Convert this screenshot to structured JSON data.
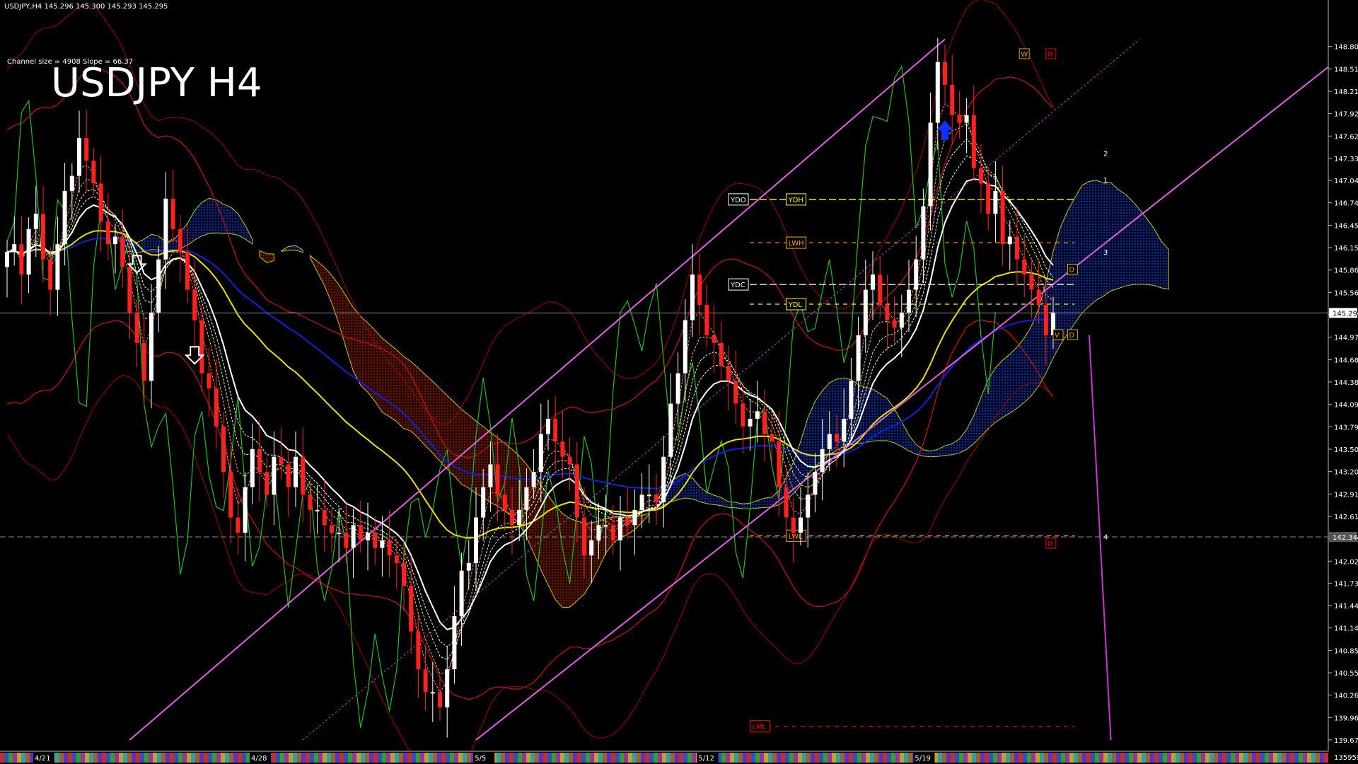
{
  "header": {
    "symbol_line": "USDJPY,H4  145.296 145.300 145.293 145.295",
    "channel_info": "Channel size = 4908  Slope = 66.37",
    "title": "USDJPY H4"
  },
  "chart_data": {
    "type": "candlestick",
    "title": "USDJPY H4",
    "ylim": [
      139.67,
      149.1
    ],
    "y_ticks": [
      "148.805",
      "148.510",
      "148.215",
      "147.920",
      "147.625",
      "147.330",
      "147.040",
      "146.745",
      "146.450",
      "146.155",
      "145.860",
      "145.565",
      "145.270",
      "144.975",
      "144.680",
      "144.385",
      "144.090",
      "143.795",
      "143.500",
      "143.205",
      "142.910",
      "142.615",
      "142.320",
      "142.025",
      "141.735",
      "141.440",
      "141.145",
      "140.850",
      "140.555",
      "140.260",
      "139.965",
      "139.670"
    ],
    "x_labels": [
      {
        "label": "4/21",
        "slot": 5
      },
      {
        "label": "4/28",
        "slot": 35
      },
      {
        "label": "5/5",
        "slot": 66
      },
      {
        "label": "5/12",
        "slot": 97
      },
      {
        "label": "5/19",
        "slot": 127
      }
    ],
    "current_price": "145.295",
    "bottom_right_value": "135959",
    "other_price_label": "142.344",
    "closes": [
      146.1,
      146.2,
      145.8,
      146.4,
      146.6,
      146.0,
      145.6,
      146.2,
      146.9,
      147.1,
      147.6,
      147.3,
      147.0,
      146.5,
      146.2,
      146.3,
      145.9,
      145.3,
      144.9,
      144.4,
      145.3,
      146.0,
      146.8,
      146.4,
      146.1,
      145.6,
      145.2,
      144.5,
      144.3,
      143.8,
      143.2,
      142.6,
      142.4,
      143.0,
      143.5,
      143.2,
      142.9,
      143.4,
      143.3,
      143.0,
      143.4,
      142.9,
      142.7,
      142.7,
      142.5,
      142.4,
      142.4,
      142.2,
      142.5,
      142.3,
      142.4,
      142.2,
      142.3,
      142.1,
      142.0,
      141.7,
      141.1,
      140.6,
      140.3,
      140.3,
      140.1,
      140.6,
      141.3,
      141.9,
      142.0,
      142.6,
      143.0,
      143.3,
      142.9,
      142.7,
      142.5,
      142.7,
      143.0,
      143.2,
      143.7,
      143.9,
      143.6,
      143.4,
      143.3,
      142.6,
      142.1,
      142.3,
      142.5,
      142.5,
      142.3,
      142.6,
      142.5,
      142.7,
      142.9,
      142.9,
      142.8,
      143.4,
      144.1,
      144.5,
      145.2,
      145.8,
      145.4,
      145.0,
      144.9,
      144.6,
      144.4,
      144.1,
      143.8,
      143.9,
      144.0,
      143.7,
      143.6,
      143.0,
      142.6,
      142.4,
      142.6,
      142.9,
      143.2,
      143.5,
      143.7,
      143.6,
      143.9,
      144.4,
      145.0,
      145.6,
      145.8,
      145.4,
      145.2,
      145.1,
      145.3,
      145.6,
      146.0,
      146.7,
      147.8,
      148.6,
      148.3,
      147.9,
      147.8,
      147.9,
      147.2,
      147.0,
      146.6,
      146.9,
      146.2,
      146.3,
      146.0,
      145.8,
      145.6,
      145.4,
      145.0,
      145.3
    ],
    "levels": [
      {
        "label": "YDO",
        "value": 146.79,
        "color": "#ffffff",
        "dash": "long"
      },
      {
        "label": "YDH",
        "value": 146.79,
        "color": "#ffff00",
        "dash": "long"
      },
      {
        "label": "LWH",
        "value": 146.22,
        "color": "#ffa500",
        "dash": "dash"
      },
      {
        "label": "YDC",
        "value": 145.67,
        "color": "#ffffff",
        "dash": "long"
      },
      {
        "label": "YDL",
        "value": 145.41,
        "color": "#ffff00",
        "dash": "dash"
      },
      {
        "label": "LWL",
        "value": 142.36,
        "color": "#ffa500",
        "dash": "dash"
      },
      {
        "label": "LML",
        "value": 139.85,
        "color": "#ff0000",
        "dash": "dash"
      }
    ],
    "right_markers": [
      "2",
      "1",
      "3",
      "4"
    ],
    "box_markers": [
      "M",
      "W",
      "D",
      "V",
      "D",
      "M"
    ]
  }
}
